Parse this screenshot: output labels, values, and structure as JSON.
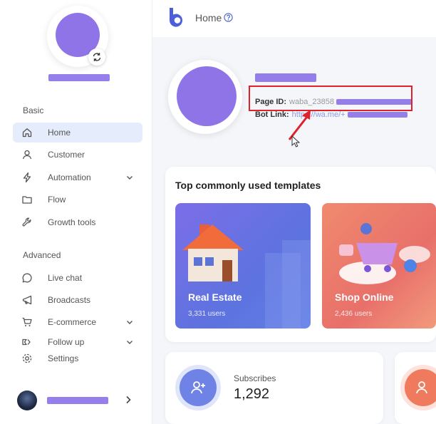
{
  "topbar": {
    "title": "Home",
    "logo_icon": "b-logo-icon",
    "help_icon": "help-circle-icon"
  },
  "sidebar": {
    "profile": {
      "sync_icon": "sync-icon"
    },
    "sections": [
      {
        "label": "Basic",
        "items": [
          {
            "label": "Home",
            "icon": "home-icon",
            "active": true
          },
          {
            "label": "Customer",
            "icon": "user-icon"
          },
          {
            "label": "Automation",
            "icon": "bolt-icon",
            "has_chevron": true
          },
          {
            "label": "Flow",
            "icon": "folder-icon"
          },
          {
            "label": "Growth tools",
            "icon": "wrench-icon"
          }
        ]
      },
      {
        "label": "Advanced",
        "items": [
          {
            "label": "Live chat",
            "icon": "chat-icon"
          },
          {
            "label": "Broadcasts",
            "icon": "megaphone-icon"
          },
          {
            "label": "E-commerce",
            "icon": "cart-icon",
            "has_chevron": true
          },
          {
            "label": "Follow up",
            "icon": "follow-up-icon",
            "has_chevron": true
          },
          {
            "label": "Settings",
            "icon": "gear-icon"
          }
        ]
      }
    ]
  },
  "profile": {
    "page_id_label": "Page ID:",
    "page_id_value": "waba_23858",
    "bot_link_label": "Bot Link:",
    "bot_link_value": "https://wa.me/+"
  },
  "templates": {
    "title": "Top commonly used templates",
    "cards": [
      {
        "title": "Real Estate",
        "users": "3,331 users"
      },
      {
        "title": "Shop Online",
        "users": "2,436 users"
      }
    ]
  },
  "stats": {
    "subscribers_label": "Subscribes",
    "subscribers_value": "1,292"
  },
  "colors": {
    "accent": "#5a6fe0",
    "redaction": "#8468e6",
    "highlight": "#e0202a"
  }
}
